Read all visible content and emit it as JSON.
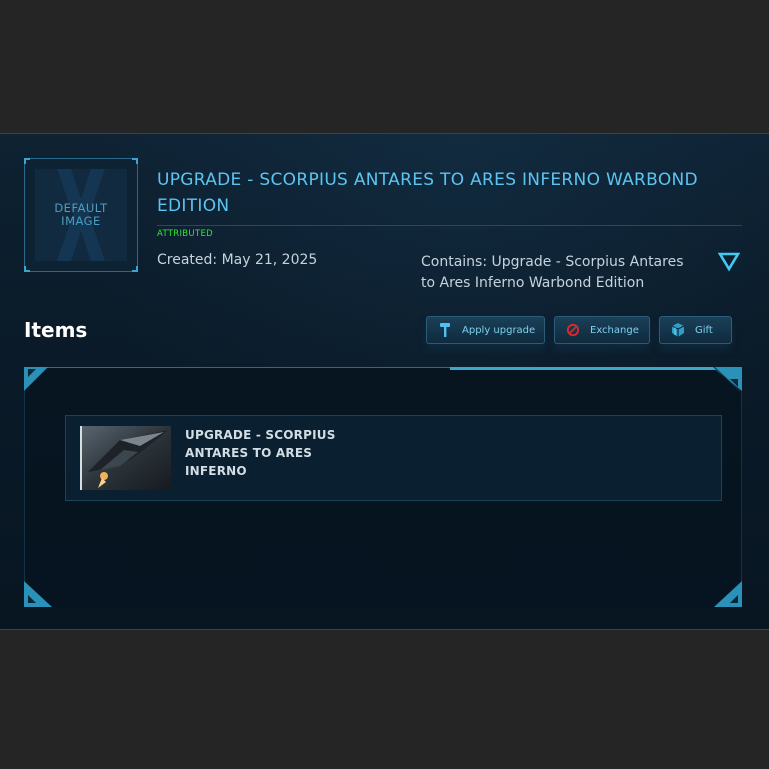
{
  "pledge": {
    "thumbnail_label": "DEFAULT IMAGE",
    "title": "UPGRADE - SCORPIUS ANTARES TO ARES INFERNO WARBOND EDITION",
    "status": "ATTRIBUTED",
    "created": "Created: May 21, 2025",
    "contains": "Contains: Upgrade - Scorpius Antares to Ares Inferno Warbond Edition"
  },
  "items_section": {
    "heading": "Items",
    "actions": {
      "apply_label": "Apply upgrade",
      "exchange_label": "Exchange",
      "gift_label": "Gift"
    },
    "list": [
      {
        "name": "UPGRADE - SCORPIUS ANTARES TO ARES INFERNO"
      }
    ]
  },
  "colors": {
    "accent": "#5cc4f0",
    "status_green": "#2fe82f",
    "background": "#252525",
    "panel": "#0a1a28"
  },
  "icons": {
    "expand": "chevron-down-icon",
    "apply": "hammer-icon",
    "exchange": "no-entry-icon",
    "gift": "gift-box-icon"
  }
}
